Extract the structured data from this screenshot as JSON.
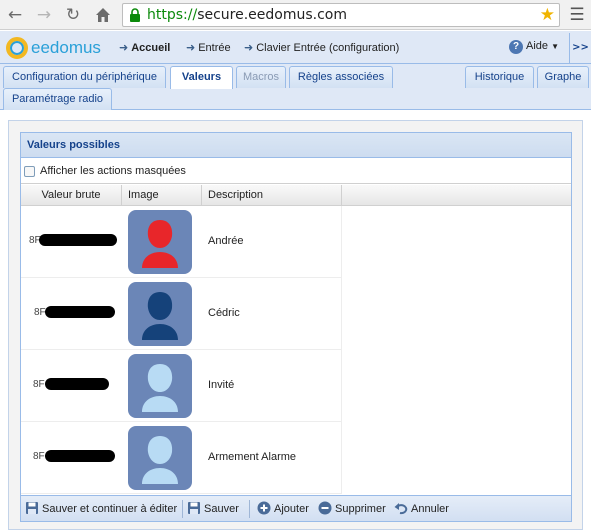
{
  "browser": {
    "url_scheme": "https://",
    "url_host": "secure.eedomus.com",
    "back_icon": "arrow-left-icon",
    "forward_icon": "arrow-right-icon",
    "reload_icon": "reload-icon",
    "home_icon": "home-icon",
    "lock_icon": "lock-icon",
    "star_icon": "star-icon",
    "menu_icon": "hamburger-menu-icon"
  },
  "header": {
    "logo_text": "eedomus",
    "breadcrumbs": [
      {
        "label": "Accueil"
      },
      {
        "label": "Entrée"
      },
      {
        "label": "Clavier Entrée (configuration)"
      }
    ],
    "help_label": "Aide",
    "expand_label": ">>"
  },
  "tabs": [
    {
      "label": "Configuration du périphérique"
    },
    {
      "label": "Valeurs"
    },
    {
      "label": "Macros"
    },
    {
      "label": "Règles associées"
    },
    {
      "label": "Historique"
    },
    {
      "label": "Graphe"
    },
    {
      "label": "Paramétrage radio"
    }
  ],
  "panel": {
    "title": "Valeurs possibles",
    "checkbox_label": "Afficher les actions masquées",
    "columns": [
      "Valeur brute",
      "Image",
      "Description"
    ],
    "rows": [
      {
        "raw_prefix": "8F",
        "image": "user-icon-red",
        "description": "Andrée",
        "color": "#e8262a"
      },
      {
        "raw_prefix": "8F",
        "image": "user-icon-dark-blue",
        "description": "Cédric",
        "color": "#15427a"
      },
      {
        "raw_prefix": "8F",
        "image": "user-icon-light-blue",
        "description": "Invité",
        "color": "#b8dbf4"
      },
      {
        "raw_prefix": "8F",
        "image": "user-icon-light-blue",
        "description": "Armement Alarme",
        "color": "#b8dbf4"
      }
    ]
  },
  "toolbar": {
    "save_continue": "Sauver et continuer à éditer",
    "save": "Sauver",
    "add": "Ajouter",
    "delete": "Supprimer",
    "cancel": "Annuler"
  }
}
